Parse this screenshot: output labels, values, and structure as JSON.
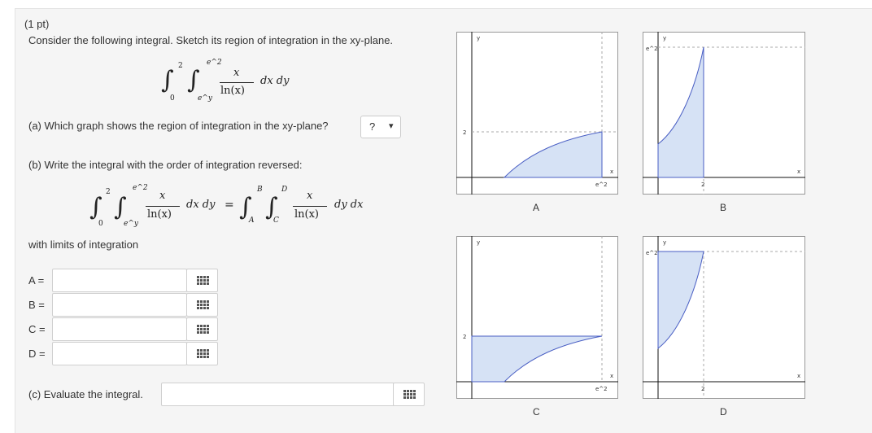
{
  "problem": {
    "points": "(1 pt)",
    "prompt": "Consider the following integral. Sketch its region of integration in the xy-plane."
  },
  "integral": {
    "outer_lower": "0",
    "outer_upper": "2",
    "inner_lower": "e^y",
    "inner_upper": "e^2",
    "numerator": "x",
    "denominator": "ln(x)",
    "differentials": "dx dy"
  },
  "part_a": {
    "question": "(a) Which graph shows the region of integration in the xy-plane?",
    "select_value": "?",
    "select_arrow": "▾"
  },
  "part_b": {
    "question": "(b) Write the integral with the order of integration reversed:",
    "rhs_outer_lower": "A",
    "rhs_outer_upper": "B",
    "rhs_inner_lower": "C",
    "rhs_inner_upper": "D",
    "rhs_differentials": "dy dx",
    "equals": "=",
    "limits_label": "with limits of integration",
    "fields": [
      {
        "label": "A =",
        "value": ""
      },
      {
        "label": "B =",
        "value": ""
      },
      {
        "label": "C =",
        "value": ""
      },
      {
        "label": "D =",
        "value": ""
      }
    ]
  },
  "part_c": {
    "question": "(c) Evaluate the integral.",
    "value": ""
  },
  "graphs": [
    {
      "id": "A",
      "caption": "A",
      "y_label": "y",
      "x_label": "x",
      "x_tick": "e^2",
      "y_tick": "2"
    },
    {
      "id": "B",
      "caption": "B",
      "y_label": "y",
      "x_label": "x",
      "x_tick": "2",
      "y_tick": "e^2"
    },
    {
      "id": "C",
      "caption": "C",
      "y_label": "y",
      "x_label": "x",
      "x_tick": "e^2",
      "y_tick": "2"
    },
    {
      "id": "D",
      "caption": "D",
      "y_label": "y",
      "x_label": "x",
      "x_tick": "2",
      "y_tick": "e^2"
    }
  ],
  "colors": {
    "region_fill": "#d6e2f5",
    "region_stroke": "#4a5fc4",
    "panel_bg": "#f5f5f5"
  }
}
